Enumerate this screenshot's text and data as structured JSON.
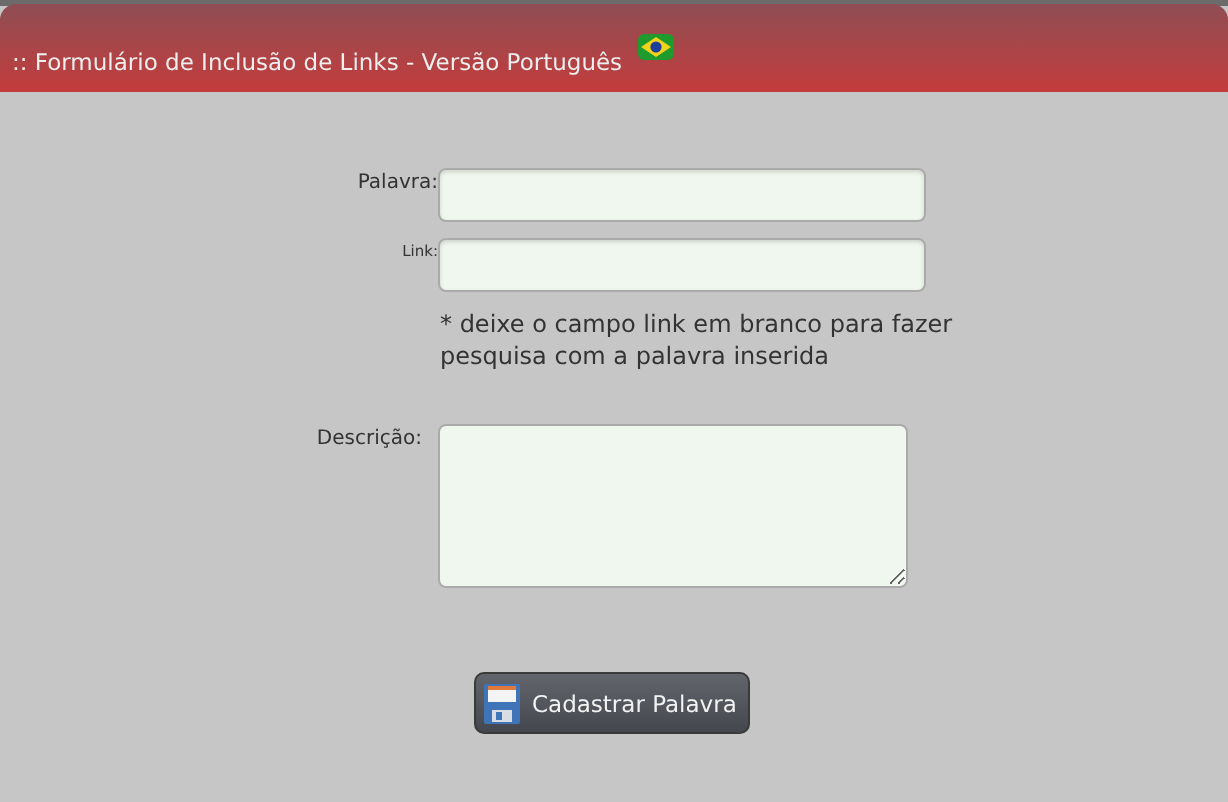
{
  "header": {
    "title": ":: Formulário de Inclusão de Links - Versão Português"
  },
  "fields": [
    {
      "kind": "input",
      "label": "Palavra:"
    },
    {
      "kind": "input",
      "label": "Link:",
      "small": true
    },
    {
      "kind": "note",
      "text": "* deixe o campo link em branco para fazer pesquisa com a palavra inserida"
    },
    {
      "kind": "textarea",
      "label": "Descrição:"
    }
  ],
  "button": {
    "label": "Cadastrar Palavra"
  }
}
